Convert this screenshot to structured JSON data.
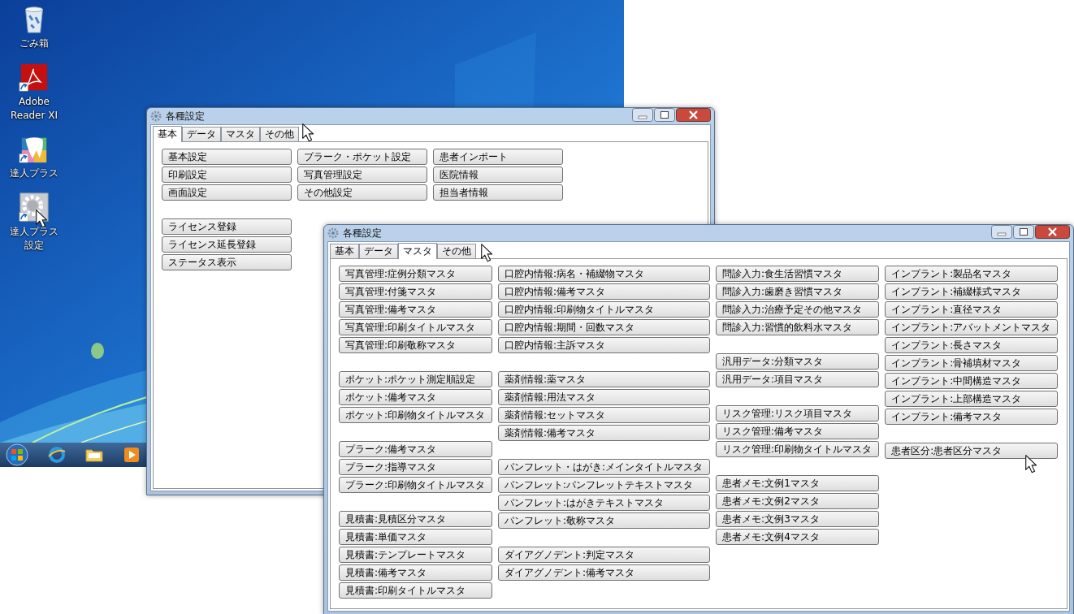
{
  "desktop": {
    "icons": [
      {
        "label": "ごみ箱",
        "kind": "trash",
        "shortcut": false
      },
      {
        "label": "Adobe Reader XI",
        "kind": "pdf",
        "shortcut": true
      },
      {
        "label": "達人プラス",
        "kind": "tooth",
        "shortcut": true
      },
      {
        "label": "達人プラス設定",
        "kind": "gear",
        "shortcut": true
      }
    ],
    "taskbar": {
      "items": [
        {
          "kind": "browser"
        },
        {
          "kind": "folder"
        },
        {
          "kind": "media"
        }
      ]
    }
  },
  "windows": [
    {
      "title": "各種設定",
      "tabs": [
        {
          "label": "基本",
          "selected": true
        },
        {
          "label": "データ",
          "selected": false
        },
        {
          "label": "マスタ",
          "selected": false
        },
        {
          "label": "その他",
          "selected": false
        }
      ],
      "columns": [
        [
          [
            "基本設定",
            "印刷設定",
            "画面設定"
          ],
          [
            "ライセンス登録",
            "ライセンス延長登録",
            "ステータス表示"
          ]
        ],
        [
          [
            "プラーク・ポケット設定",
            "写真管理設定",
            "その他設定"
          ]
        ],
        [
          [
            "患者インポート",
            "医院情報",
            "担当者情報"
          ]
        ]
      ]
    },
    {
      "title": "各種設定",
      "tabs": [
        {
          "label": "基本",
          "selected": false
        },
        {
          "label": "データ",
          "selected": false
        },
        {
          "label": "マスタ",
          "selected": true
        },
        {
          "label": "その他",
          "selected": false
        }
      ],
      "columns": [
        [
          [
            "写真管理:症例分類マスタ",
            "写真管理:付箋マスタ",
            "写真管理:備考マスタ",
            "写真管理:印刷タイトルマスタ",
            "写真管理:印刷敬称マスタ"
          ],
          [
            "ポケット:ポケット測定順設定",
            "ポケット:備考マスタ",
            "ポケット:印刷物タイトルマスタ"
          ],
          [
            "プラーク:備考マスタ",
            "プラーク:指導マスタ",
            "プラーク:印刷物タイトルマスタ"
          ],
          [
            "見積書:見積区分マスタ",
            "見積書:単価マスタ",
            "見積書:テンプレートマスタ",
            "見積書:備考マスタ",
            "見積書:印刷タイトルマスタ"
          ]
        ],
        [
          [
            "口腔内情報:病名・補綴物マスタ",
            "口腔内情報:備考マスタ",
            "口腔内情報:印刷物タイトルマスタ",
            "口腔内情報:期間・回数マスタ",
            "口腔内情報:主訴マスタ"
          ],
          [
            "薬剤情報:薬マスタ",
            "薬剤情報:用法マスタ",
            "薬剤情報:セットマスタ",
            "薬剤情報:備考マスタ"
          ],
          [
            "パンフレット・はがき:メインタイトルマスタ",
            "パンフレット:パンフレットテキストマスタ",
            "パンフレット:はがきテキストマスタ",
            "パンフレット:敬称マスタ"
          ],
          [
            "ダイアグノデント:判定マスタ",
            "ダイアグノデント:備考マスタ"
          ]
        ],
        [
          [
            "問診入力:食生活習慣マスタ",
            "問診入力:歯磨き習慣マスタ",
            "問診入力:治療予定その他マスタ",
            "問診入力:習慣的飲料水マスタ"
          ],
          [
            "汎用データ:分類マスタ",
            "汎用データ:項目マスタ"
          ],
          [
            "リスク管理:リスク項目マスタ",
            "リスク管理:備考マスタ",
            "リスク管理:印刷物タイトルマスタ"
          ],
          [
            "患者メモ:文例1マスタ",
            "患者メモ:文例2マスタ",
            "患者メモ:文例3マスタ",
            "患者メモ:文例4マスタ"
          ]
        ],
        [
          [
            "インプラント:製品名マスタ",
            "インプラント:補綴様式マスタ",
            "インプラント:直径マスタ",
            "インプラント:アバットメントマスタ",
            "インプラント:長さマスタ",
            "インプラント:骨補填材マスタ",
            "インプラント:中間構造マスタ",
            "インプラント:上部構造マスタ",
            "インプラント:備考マスタ"
          ],
          [
            "患者区分:患者区分マスタ"
          ]
        ]
      ]
    }
  ]
}
